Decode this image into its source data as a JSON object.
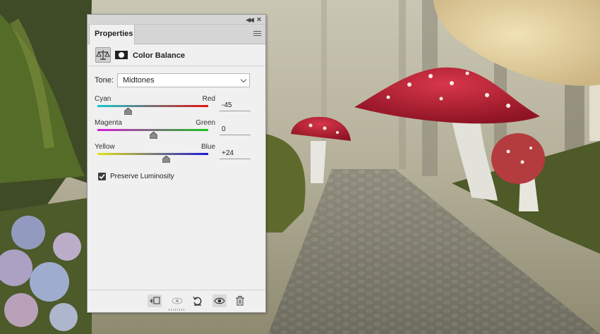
{
  "panel": {
    "tab_label": "Properties",
    "adjustment_title": "Color Balance",
    "tone": {
      "label": "Tone:",
      "selected": "Midtones"
    },
    "sliders": [
      {
        "left_label": "Cyan",
        "right_label": "Red",
        "value": "-45",
        "numeric": -45,
        "left_color": "#13c7d0",
        "right_color": "#e21212"
      },
      {
        "left_label": "Magenta",
        "right_label": "Green",
        "value": "0",
        "numeric": 0,
        "left_color": "#d91ad9",
        "right_color": "#1bc41b"
      },
      {
        "left_label": "Yellow",
        "right_label": "Blue",
        "value": "+24",
        "numeric": 24,
        "left_color": "#e1e114",
        "right_color": "#1a1ad6"
      }
    ],
    "slider_range": [
      -100,
      100
    ],
    "preserve_luminosity": {
      "label": "Preserve Luminosity",
      "checked": true
    },
    "footer_icons": [
      "clip-to-layer-icon",
      "view-previous-state-icon",
      "reset-icon",
      "visibility-eye-icon",
      "trash-icon"
    ],
    "topbar_icons": [
      "collapse-icon",
      "close-icon"
    ],
    "menu_icon": "panel-menu-icon"
  },
  "colors": {
    "panel_bg": "#f0f0f0",
    "mushroom_red": "#c8283a"
  }
}
